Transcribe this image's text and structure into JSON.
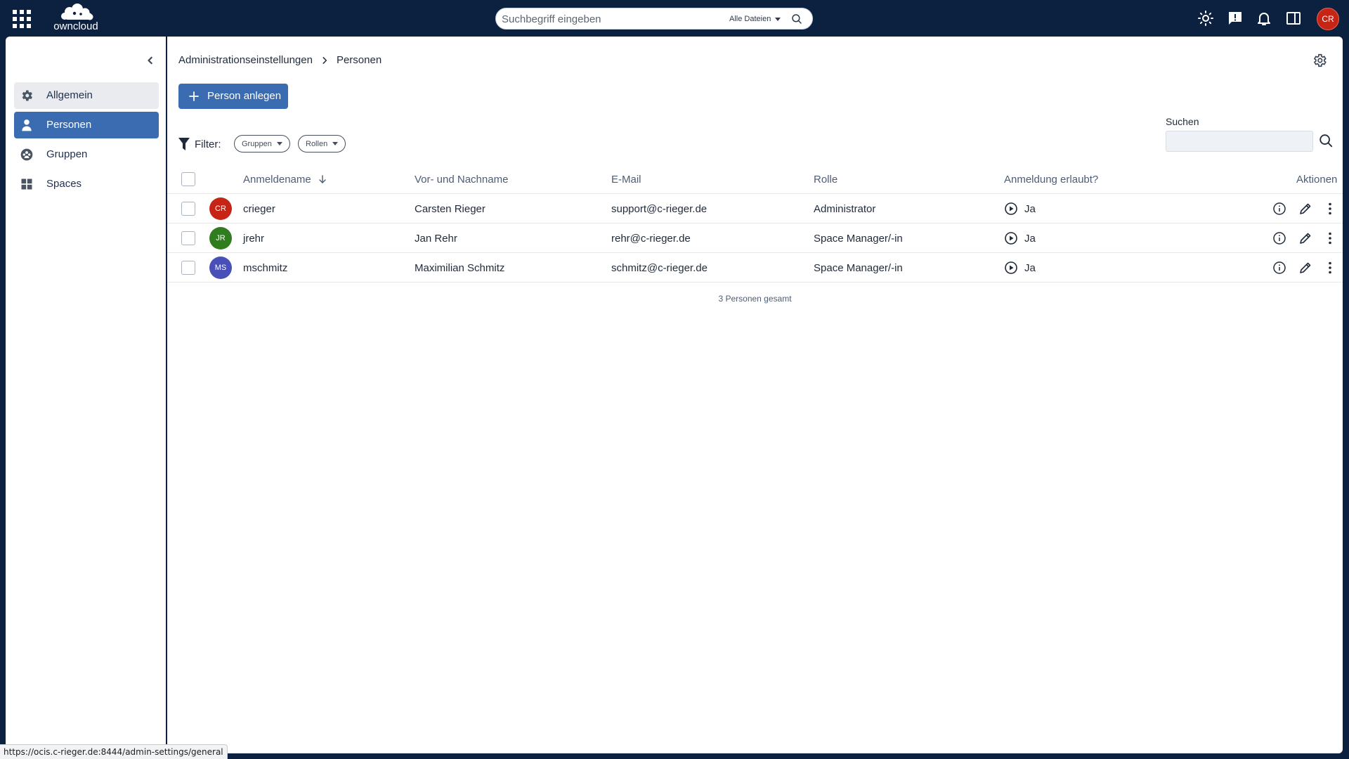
{
  "topbar": {
    "logo_text": "owncloud",
    "search": {
      "placeholder": "Suchbegriff eingeben",
      "scope": "Alle Dateien"
    },
    "icons": [
      "apps-grid-icon",
      "sun-icon",
      "feedback-icon",
      "bell-icon",
      "sidebar-toggle-icon"
    ],
    "avatar_initials": "CR"
  },
  "sidebar": {
    "items": [
      {
        "label": "Allgemein",
        "icon": "gear-icon",
        "state": "hover"
      },
      {
        "label": "Personen",
        "icon": "person-icon",
        "state": "active"
      },
      {
        "label": "Gruppen",
        "icon": "groups-icon",
        "state": "normal"
      },
      {
        "label": "Spaces",
        "icon": "spaces-grid-icon",
        "state": "normal"
      }
    ]
  },
  "main": {
    "breadcrumb": {
      "parent": "Administrationseinstellungen",
      "current": "Personen"
    },
    "create_button": "Person anlegen",
    "search_label": "Suchen",
    "search_value": "",
    "filter": {
      "label": "Filter:",
      "chips": [
        "Gruppen",
        "Rollen"
      ]
    },
    "table": {
      "headers": {
        "username": "Anmeldename",
        "name": "Vor- und Nachname",
        "email": "E-Mail",
        "role": "Rolle",
        "login": "Anmeldung erlaubt?",
        "actions": "Aktionen"
      },
      "rows": [
        {
          "initials": "CR",
          "avatar_color": "#c62415",
          "username": "crieger",
          "name": "Carsten Rieger",
          "email": "support@c-rieger.de",
          "role": "Administrator",
          "login": "Ja"
        },
        {
          "initials": "JR",
          "avatar_color": "#2f7d1e",
          "username": "jrehr",
          "name": "Jan Rehr",
          "email": "rehr@c-rieger.de",
          "role": "Space Manager/-in",
          "login": "Ja"
        },
        {
          "initials": "MS",
          "avatar_color": "#4850b8",
          "username": "mschmitz",
          "name": "Maximilian Schmitz",
          "email": "schmitz@c-rieger.de",
          "role": "Space Manager/-in",
          "login": "Ja"
        }
      ],
      "total": "3 Personen gesamt"
    }
  },
  "status_url": "https://ocis.c-rieger.de:8444/admin-settings/general",
  "colors": {
    "topbar": "#0c2040",
    "accent": "#3b6bb0",
    "hover": "#e9ebee"
  }
}
